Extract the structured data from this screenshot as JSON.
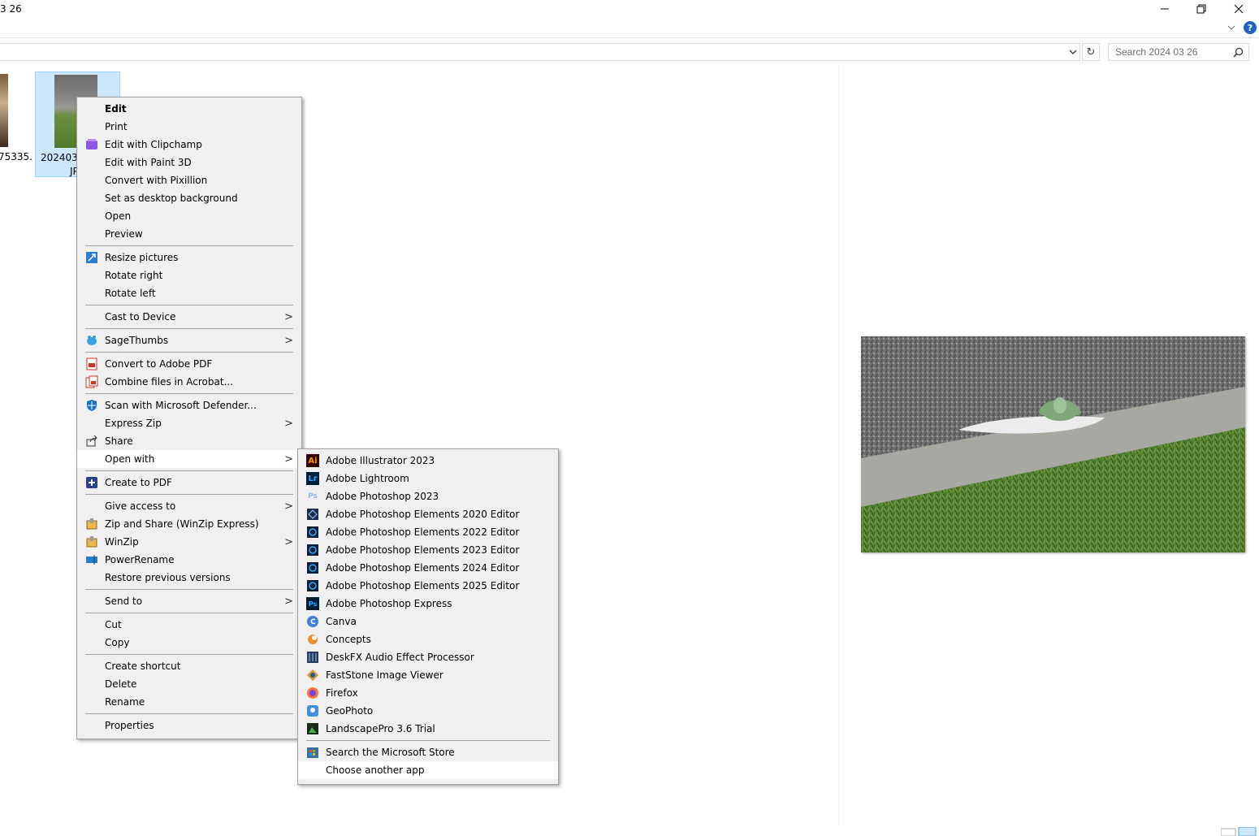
{
  "window": {
    "title": "3 26"
  },
  "address": {
    "search_placeholder": "Search 2024 03 26"
  },
  "files": {
    "left_label": "75335.",
    "selected_label_line1": "2024032",
    "selected_label_line2": "JP"
  },
  "context_menu": {
    "items": [
      {
        "label": "Edit",
        "bold": true
      },
      {
        "label": "Print"
      },
      {
        "label": "Edit with Clipchamp",
        "icon": "clipchamp-icon"
      },
      {
        "label": "Edit with Paint 3D"
      },
      {
        "label": "Convert with Pixillion"
      },
      {
        "label": "Set as desktop background"
      },
      {
        "label": "Open"
      },
      {
        "label": "Preview"
      },
      {
        "label": "Resize pictures",
        "icon": "resize-pictures-icon"
      },
      {
        "label": "Rotate right"
      },
      {
        "label": "Rotate left"
      },
      {
        "label": "Cast to Device",
        "submenu": true
      },
      {
        "label": "SageThumbs",
        "icon": "sagethumbs-icon",
        "submenu": true
      },
      {
        "label": "Convert to Adobe PDF",
        "icon": "adobe-pdf-icon"
      },
      {
        "label": "Combine files in Acrobat...",
        "icon": "acrobat-combine-icon"
      },
      {
        "label": "Scan with Microsoft Defender...",
        "icon": "defender-icon"
      },
      {
        "label": "Express Zip",
        "submenu": true
      },
      {
        "label": "Share",
        "icon": "share-icon"
      },
      {
        "label": "Open with",
        "submenu": true
      },
      {
        "label": "Create to PDF",
        "icon": "create-pdf-icon"
      },
      {
        "label": "Give access to",
        "submenu": true
      },
      {
        "label": "Zip and Share (WinZip Express)",
        "icon": "winzip-express-icon"
      },
      {
        "label": "WinZip",
        "icon": "winzip-icon",
        "submenu": true
      },
      {
        "label": "PowerRename",
        "icon": "powerrename-icon"
      },
      {
        "label": "Restore previous versions"
      },
      {
        "label": "Send to",
        "submenu": true
      },
      {
        "label": "Cut"
      },
      {
        "label": "Copy"
      },
      {
        "label": "Create shortcut"
      },
      {
        "label": "Delete"
      },
      {
        "label": "Rename"
      },
      {
        "label": "Properties"
      }
    ]
  },
  "open_with_menu": {
    "items": [
      {
        "label": "Adobe Illustrator 2023",
        "icon": "illustrator-icon"
      },
      {
        "label": "Adobe Lightroom",
        "icon": "lightroom-icon"
      },
      {
        "label": "Adobe Photoshop 2023",
        "icon": "photoshop-icon"
      },
      {
        "label": "Adobe Photoshop Elements 2020 Editor",
        "icon": "elements-2020-icon"
      },
      {
        "label": "Adobe Photoshop Elements 2022 Editor",
        "icon": "elements-2022-icon"
      },
      {
        "label": "Adobe Photoshop Elements 2023 Editor",
        "icon": "elements-2023-icon"
      },
      {
        "label": "Adobe Photoshop Elements 2024 Editor",
        "icon": "elements-2024-icon"
      },
      {
        "label": "Adobe Photoshop Elements 2025 Editor",
        "icon": "elements-2025-icon"
      },
      {
        "label": "Adobe Photoshop Express",
        "icon": "photoshop-express-icon"
      },
      {
        "label": "Canva",
        "icon": "canva-icon"
      },
      {
        "label": "Concepts",
        "icon": "concepts-icon"
      },
      {
        "label": "DeskFX Audio Effect Processor",
        "icon": "deskfx-icon"
      },
      {
        "label": "FastStone Image Viewer",
        "icon": "faststone-icon"
      },
      {
        "label": "Firefox",
        "icon": "firefox-icon"
      },
      {
        "label": "GeoPhoto",
        "icon": "geophoto-icon"
      },
      {
        "label": "LandscapePro 3.6 Trial",
        "icon": "landscapepro-icon"
      },
      {
        "label": "Search the Microsoft Store",
        "icon": "microsoft-store-icon"
      },
      {
        "label": "Choose another app"
      }
    ]
  }
}
